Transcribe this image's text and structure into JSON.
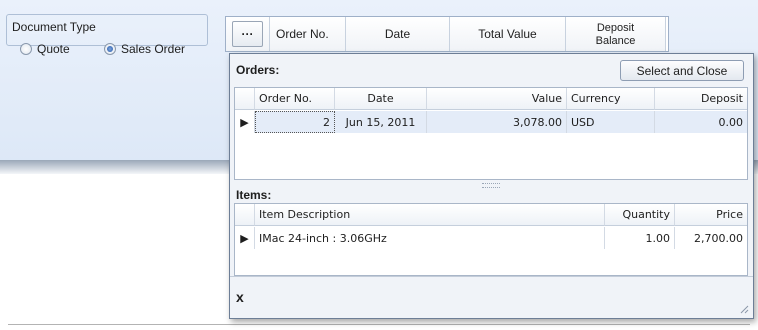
{
  "document_type": {
    "legend": "Document Type",
    "options": [
      {
        "label": "Quote",
        "checked": false
      },
      {
        "label": "Sales Order",
        "checked": true
      }
    ]
  },
  "header_grid": {
    "ellipsis": "···",
    "columns": [
      "Order No.",
      "Date",
      "Total Value"
    ],
    "deposit_line1": "Deposit",
    "deposit_line2": "Balance"
  },
  "popup": {
    "orders_title": "Orders:",
    "select_and_close": "Select and Close",
    "orders_columns": [
      "Order No.",
      "Date",
      "Value",
      "Currency",
      "Deposit"
    ],
    "orders_rows": [
      {
        "order_no": "2",
        "date": "Jun 15, 2011",
        "value": "3,078.00",
        "currency": "USD",
        "deposit": "0.00"
      }
    ],
    "items_title": "Items:",
    "items_columns": [
      "Item Description",
      "Quantity",
      "Price"
    ],
    "items_rows": [
      {
        "description": "IMac  24-inch : 3.06GHz",
        "quantity": "1.00",
        "price": "2,700.00"
      }
    ],
    "close_label": "x"
  },
  "icons": {
    "row_indicator": "triangle-right-icon",
    "close": "close-icon",
    "resize": "resize-grip-icon"
  }
}
